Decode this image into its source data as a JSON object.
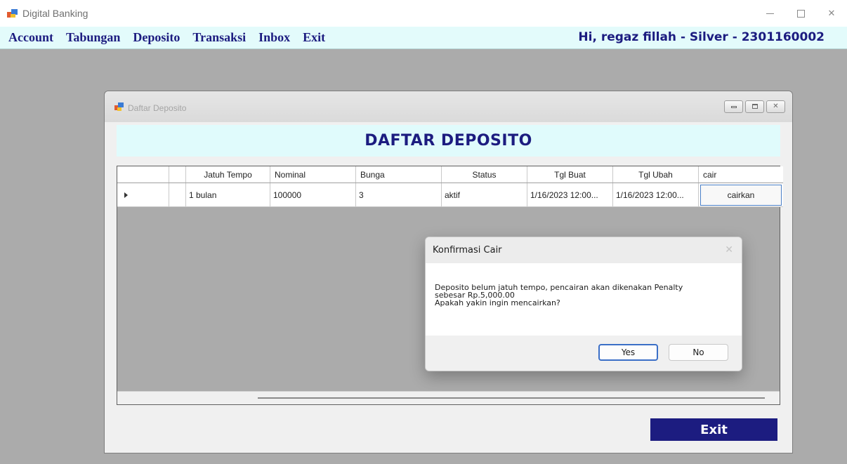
{
  "app": {
    "title": "Digital Banking"
  },
  "menu": {
    "items": [
      "Account",
      "Tabungan",
      "Deposito",
      "Transaksi",
      "Inbox",
      "Exit"
    ],
    "greeting": "Hi, regaz fillah - Silver - 2301160002"
  },
  "child_window": {
    "title": "Daftar Deposito",
    "header": "DAFTAR DEPOSITO"
  },
  "grid": {
    "columns": [
      "Jatuh Tempo",
      "Nominal",
      "Bunga",
      "Status",
      "Tgl Buat",
      "Tgl Ubah",
      "cair"
    ],
    "rows": [
      {
        "jatuh_tempo": "1 bulan",
        "nominal": "100000",
        "bunga": "3",
        "status": "aktif",
        "tgl_buat": "1/16/2023 12:00...",
        "tgl_ubah": "1/16/2023 12:00...",
        "cair": "cairkan"
      }
    ]
  },
  "exit_button": "Exit",
  "dialog": {
    "title": "Konfirmasi Cair",
    "message_lines": [
      "Deposito belum jatuh tempo, pencairan akan dikenakan Penalty",
      "sebesar Rp.5,000.00",
      "Apakah yakin ingin mencairkan?"
    ],
    "yes_label": "Yes",
    "no_label": "No"
  }
}
